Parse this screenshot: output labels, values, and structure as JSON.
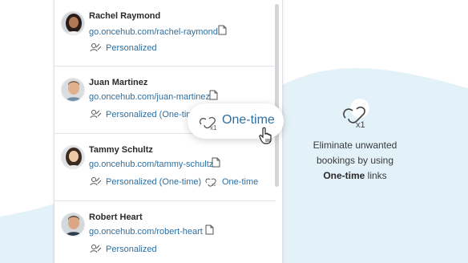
{
  "users": [
    {
      "name": "Rachel Raymond",
      "link": "go.oncehub.com/rachel-raymond",
      "tags": [
        "Personalized"
      ],
      "icon": "avatar-rachel"
    },
    {
      "name": "Juan Martinez",
      "link": "go.oncehub.com/juan-martinez",
      "tags": [
        "Personalized (One-time)"
      ],
      "icon": "avatar-juan"
    },
    {
      "name": "Tammy Schultz",
      "link": "go.oncehub.com/tammy-schultz",
      "tags": [
        "Personalized (One-time)",
        "One-time"
      ],
      "icon": "avatar-tammy"
    },
    {
      "name": "Robert Heart",
      "link": "go.oncehub.com/robert-heart",
      "tags": [
        "Personalized"
      ],
      "icon": "avatar-robert"
    }
  ],
  "tooltip": {
    "label": "One-time"
  },
  "info": {
    "line1": "Eliminate unwanted",
    "line2": "bookings by using",
    "line3_bold": "One-time",
    "line3_rest": " links"
  },
  "colors": {
    "link": "#2f6f9f",
    "wave": "#e3f1f9"
  }
}
